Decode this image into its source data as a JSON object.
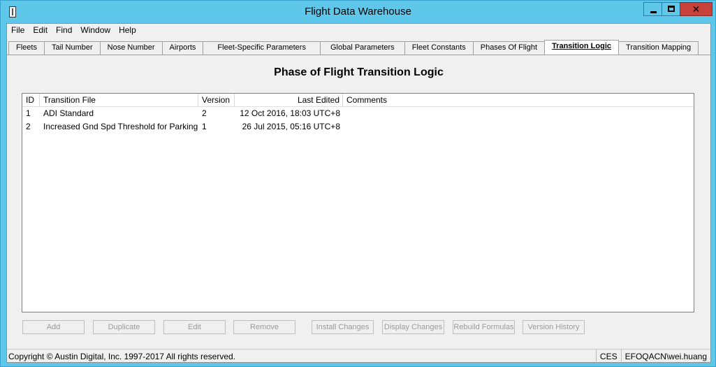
{
  "window": {
    "title": "Flight Data Warehouse",
    "controls": {
      "minimize": "minimize",
      "maximize": "maximize",
      "close": "✕"
    }
  },
  "menu": [
    "File",
    "Edit",
    "Find",
    "Window",
    "Help"
  ],
  "tabs": [
    {
      "label": "Fleets"
    },
    {
      "label": "Tail Number"
    },
    {
      "label": "Nose Number"
    },
    {
      "label": "Airports"
    },
    {
      "label": "Fleet-Specific Parameters"
    },
    {
      "label": "Global Parameters"
    },
    {
      "label": "Fleet Constants"
    },
    {
      "label": "Phases Of Flight"
    },
    {
      "label": "Transition Logic",
      "active": true
    },
    {
      "label": "Transition Mapping"
    }
  ],
  "panel": {
    "title": "Phase of Flight Transition Logic"
  },
  "table": {
    "columns": [
      "ID",
      "Transition File",
      "Version",
      "Last Edited",
      "Comments"
    ],
    "rows": [
      [
        "1",
        "ADI Standard",
        "2",
        "12 Oct 2016, 18:03 UTC+8",
        ""
      ],
      [
        "2",
        "Increased Gnd Spd Threshold for Parking",
        "1",
        "26 Jul 2015, 05:16 UTC+8",
        ""
      ]
    ]
  },
  "buttons": [
    "Add",
    "Duplicate",
    "Edit",
    "Remove",
    "Install Changes",
    "Display Changes",
    "Rebuild Formulas",
    "Version History"
  ],
  "status": {
    "copyright": "Copyright © Austin Digital, Inc. 1997-2017 All rights reserved.",
    "mode": "CES",
    "user": "EFOQACN\\wei.huang"
  }
}
